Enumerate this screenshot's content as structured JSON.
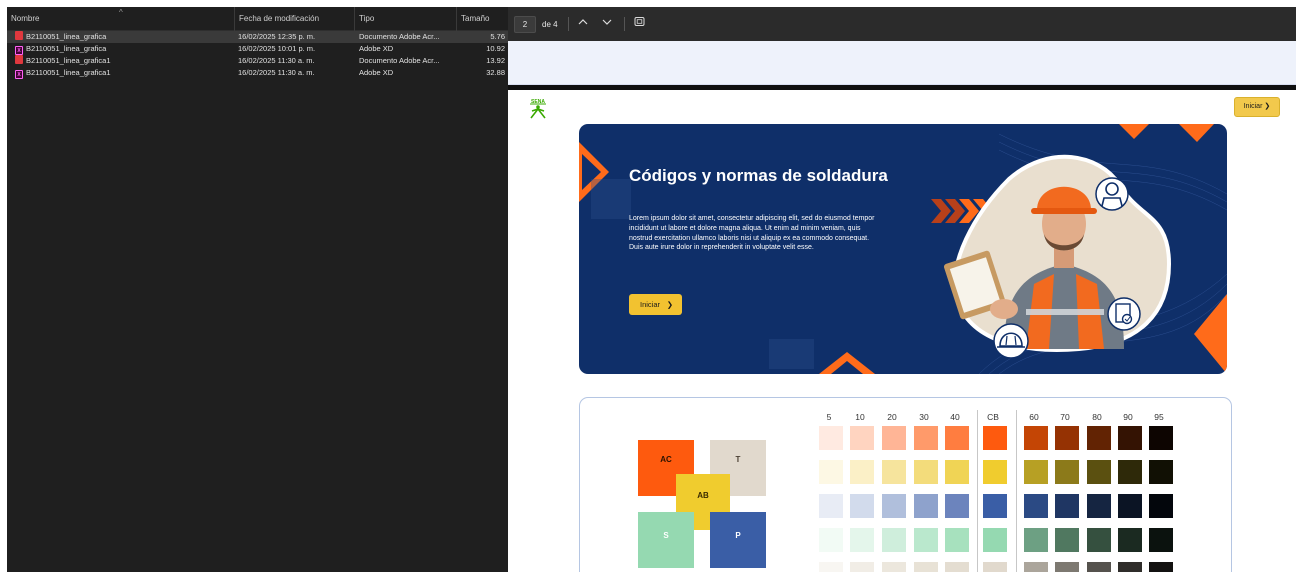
{
  "explorer": {
    "columns": [
      "Nombre",
      "Fecha de modificación",
      "Tipo",
      "Tamaño"
    ],
    "files": [
      {
        "name": "B2110051_linea_grafica",
        "date": "16/02/2025 12:35 p. m.",
        "type": "Documento Adobe Acr...",
        "size": "5.76",
        "icon": "pdf-icon",
        "selected": true
      },
      {
        "name": "B2110051_linea_grafica",
        "date": "16/02/2025 10:01 p. m.",
        "type": "Adobe XD",
        "size": "10.92",
        "icon": "xd-icon",
        "selected": false
      },
      {
        "name": "B2110051_linea_grafica1",
        "date": "16/02/2025 11:30 a. m.",
        "type": "Documento Adobe Acr...",
        "size": "13.92",
        "icon": "pdf-icon",
        "selected": false
      },
      {
        "name": "B2110051_linea_grafica1",
        "date": "16/02/2025 11:30 a. m.",
        "type": "Adobe XD",
        "size": "32.88",
        "icon": "xd-icon",
        "selected": false
      }
    ]
  },
  "viewer": {
    "page_current": "2",
    "page_total": "de 4",
    "icons": [
      "chevron-up-icon",
      "chevron-down-icon",
      "fit-page-icon"
    ]
  },
  "doc": {
    "logo_text": "SENA",
    "top_button": "Iniciar",
    "hero": {
      "title": "Códigos y normas de soldadura",
      "body": "Lorem ipsum dolor sit amet, consectetur adipiscing elit, sed do eiusmod tempor incididunt ut labore et dolore magna aliqua. Ut enim ad minim veniam, quis nostrud exercitation ullamco laboris nisi ut aliquip ex ea commodo consequat. Duis aute irure dolor in reprehenderit in voluptate velit esse.",
      "button": "Iniciar"
    },
    "palette": {
      "tiles": [
        {
          "label": "AC",
          "color": "#fe5a0e"
        },
        {
          "label": "T",
          "color": "#e1d9cd"
        },
        {
          "label": "AB",
          "color": "#f0cc2e"
        },
        {
          "label": "S",
          "color": "#95d9b1"
        },
        {
          "label": "P",
          "color": "#3a5ea6"
        }
      ],
      "headers": [
        "5",
        "10",
        "20",
        "30",
        "40",
        "CB",
        "60",
        "70",
        "80",
        "90",
        "95"
      ],
      "rows": [
        [
          "#ffeae1",
          "#ffd4c0",
          "#ffb596",
          "#ff9a6a",
          "#ff7d40",
          "#fe5a0e",
          "#c44505",
          "#953203",
          "#622303",
          "#341303",
          "#0d0501"
        ],
        [
          "#fdf8e4",
          "#fbf0c7",
          "#f6e49d",
          "#f3dc7b",
          "#f0d455",
          "#f0cc2e",
          "#b7a024",
          "#8c7a1a",
          "#5b5010",
          "#2e2909",
          "#111004"
        ],
        [
          "#e8ecf5",
          "#d2dbec",
          "#b0bfdc",
          "#8ea2cc",
          "#6c84bd",
          "#3a5ea6",
          "#2b4a84",
          "#1f3663",
          "#152541",
          "#0b1424",
          "#03060c"
        ],
        [
          "#f2fbf5",
          "#e4f6eb",
          "#cfeedc",
          "#bae8cd",
          "#a7e1be",
          "#95d9b1",
          "#6da083",
          "#507860",
          "#35503f",
          "#1b2a21",
          "#0b120e"
        ],
        [
          "#f8f6f2",
          "#f1ede6",
          "#ece7dd",
          "#e8e2d6",
          "#e4ddd1",
          "#e1d9cd",
          "#aba59b",
          "#7d7971",
          "#55524d",
          "#2f2d2a",
          "#131211"
        ]
      ]
    }
  }
}
